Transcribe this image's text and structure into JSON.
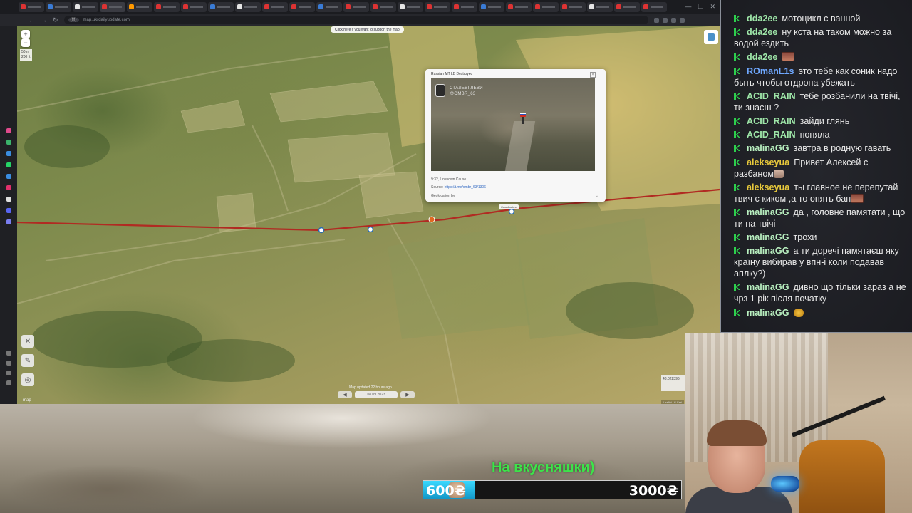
{
  "browser": {
    "url": "map.ukrdailyupdate.com",
    "url_chip": "(!!!)",
    "window_controls": [
      "—",
      "❐",
      "✕"
    ],
    "tab_colors": [
      "#d33",
      "#3a7bd5",
      "#e5e5e5",
      "#d33",
      "#ff9900",
      "#d33",
      "#d33",
      "#3a7bd5",
      "#e5e5e5",
      "#d33",
      "#d33",
      "#3a7bd5",
      "#d33",
      "#d33",
      "#e5e5e5",
      "#d33",
      "#d33",
      "#3a7bd5",
      "#d33",
      "#d33",
      "#d33",
      "#e5e5e5",
      "#d33",
      "#d33"
    ]
  },
  "map": {
    "support_banner": "Click here if you want to support the map",
    "scale": [
      "50 m",
      "200 ft"
    ],
    "zoom_in": "+",
    "zoom_out": "−",
    "map_updated": "Map updated 22 hours ago",
    "date": "08.09.2023",
    "prev_label": "◀",
    "next_label": "▶",
    "coords": "48.022396",
    "attribution": "Leaflet | © Esri",
    "logo": "map",
    "pin_label": "Coordinates",
    "tools": [
      "✕",
      "✎",
      "◎"
    ]
  },
  "popup": {
    "title": "Russian MT LB Destroyed",
    "close": "×",
    "video_overlay": [
      "СТАЛЕВІ ЛЕВИ",
      "@OMBR_63"
    ],
    "caption": "9:32, Unknown Cause",
    "source_label": "Source:",
    "source_url": "https://t.me/ombr_63/1306",
    "geolocated_label": "Geolocation by",
    "scroll_hint": "⌄"
  },
  "chat": {
    "messages": [
      {
        "user": "dda2ee",
        "color": "#9ee6a8",
        "text": "мотоцикл с ванной"
      },
      {
        "user": "dda2ee",
        "color": "#9ee6a8",
        "text": "ну кста на таком можно за водой ездить"
      },
      {
        "user": "dda2ee",
        "color": "#9ee6a8",
        "text": "",
        "emote": "emote"
      },
      {
        "user": "ROmanL1s",
        "color": "#6fa8ff",
        "text": "это тебе как соник надо быть чтобы отдрона убежать"
      },
      {
        "user": "ACID_RAIN",
        "color": "#9ee6a8",
        "text": "тебе розбанили на твічі, ти знаєш ?"
      },
      {
        "user": "ACID_RAIN",
        "color": "#9ee6a8",
        "text": "зайди глянь"
      },
      {
        "user": "ACID_RAIN",
        "color": "#9ee6a8",
        "text": "поняла"
      },
      {
        "user": "malinaGG",
        "color": "#b9f0c0",
        "text": "завтра в родную гавать"
      },
      {
        "user": "alekseyua",
        "color": "#e8c93b",
        "text": "Привет Алексей с разбаном",
        "emote": "face"
      },
      {
        "user": "alekseyua",
        "color": "#e8c93b",
        "text": "ты главное не перепутай твич с киком ,а то опять бан",
        "emote": "emote"
      },
      {
        "user": "malinaGG",
        "color": "#b9f0c0",
        "text": "да , головне памятати , що ти на твічі"
      },
      {
        "user": "malinaGG",
        "color": "#b9f0c0",
        "text": "трохи"
      },
      {
        "user": "malinaGG",
        "color": "#b9f0c0",
        "text": "а ти доречі памятаєш яку країну вибирав у впн-і коли подавав аплку?)"
      },
      {
        "user": "malinaGG",
        "color": "#b9f0c0",
        "text": "дивно що тільки зараз а не чрз 1 рік після початку"
      },
      {
        "user": "malinaGG",
        "color": "#b9f0c0",
        "text": "",
        "emote": "small"
      }
    ]
  },
  "donation": {
    "label": "На вкусняшки)",
    "current": "600₴",
    "goal": "3000₴",
    "progress_fraction": 0.2
  }
}
